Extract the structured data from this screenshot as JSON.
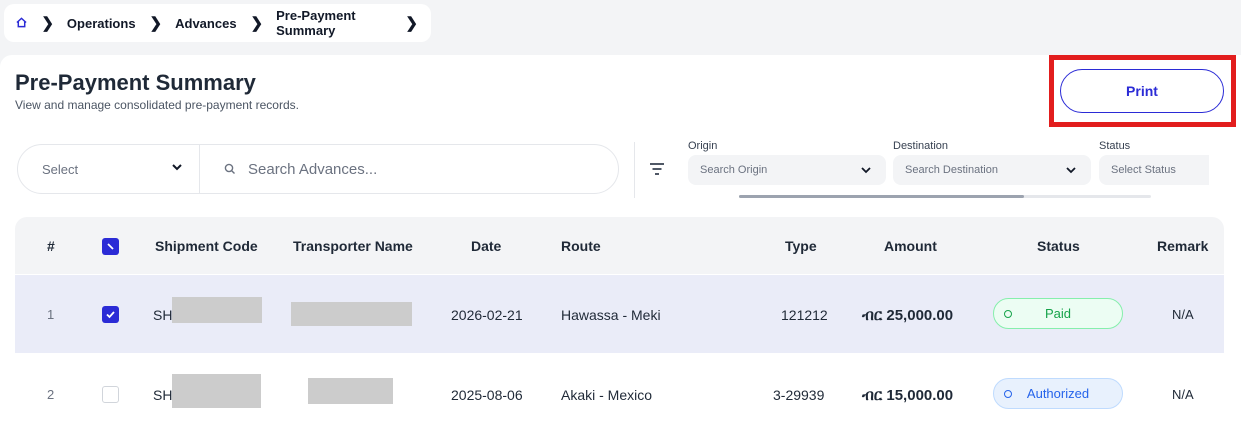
{
  "breadcrumb": {
    "items": [
      "Operations",
      "Advances",
      "Pre-Payment Summary"
    ]
  },
  "header": {
    "title": "Pre-Payment Summary",
    "subtitle": "View and manage consolidated pre-payment records.",
    "print_label": "Print"
  },
  "filters": {
    "select_placeholder": "Select",
    "search_placeholder": "Search Advances...",
    "origin": {
      "label": "Origin",
      "placeholder": "Search Origin"
    },
    "destination": {
      "label": "Destination",
      "placeholder": "Search Destination"
    },
    "status": {
      "label": "Status",
      "placeholder": "Select Status"
    }
  },
  "table": {
    "columns": [
      "#",
      "Shipment Code",
      "Transporter Name",
      "Date",
      "Route",
      "Type",
      "Amount",
      "Status",
      "Remark"
    ],
    "rows": [
      {
        "index": "1",
        "shipment_code": "SHI",
        "date": "2026-02-21",
        "route": "Hawassa - Meki",
        "type": "121212",
        "amount": "ብር 25,000.00",
        "status": "Paid",
        "remark": "N/A",
        "checked": true
      },
      {
        "index": "2",
        "shipment_code": "SHI",
        "date": "2025-08-06",
        "route": "Akaki - Mexico",
        "type": "3-29939",
        "amount": "ብር 15,000.00",
        "status": "Authorized",
        "remark": "N/A",
        "checked": false
      }
    ]
  },
  "colors": {
    "accent": "#2b2bd6",
    "highlight": "#e21d1d",
    "paid": "#16a34a",
    "authorized": "#2563eb"
  },
  "icons": [
    "home-icon",
    "chevron-right-icon",
    "chevron-down-icon",
    "search-icon",
    "filter-icon",
    "check-icon"
  ]
}
